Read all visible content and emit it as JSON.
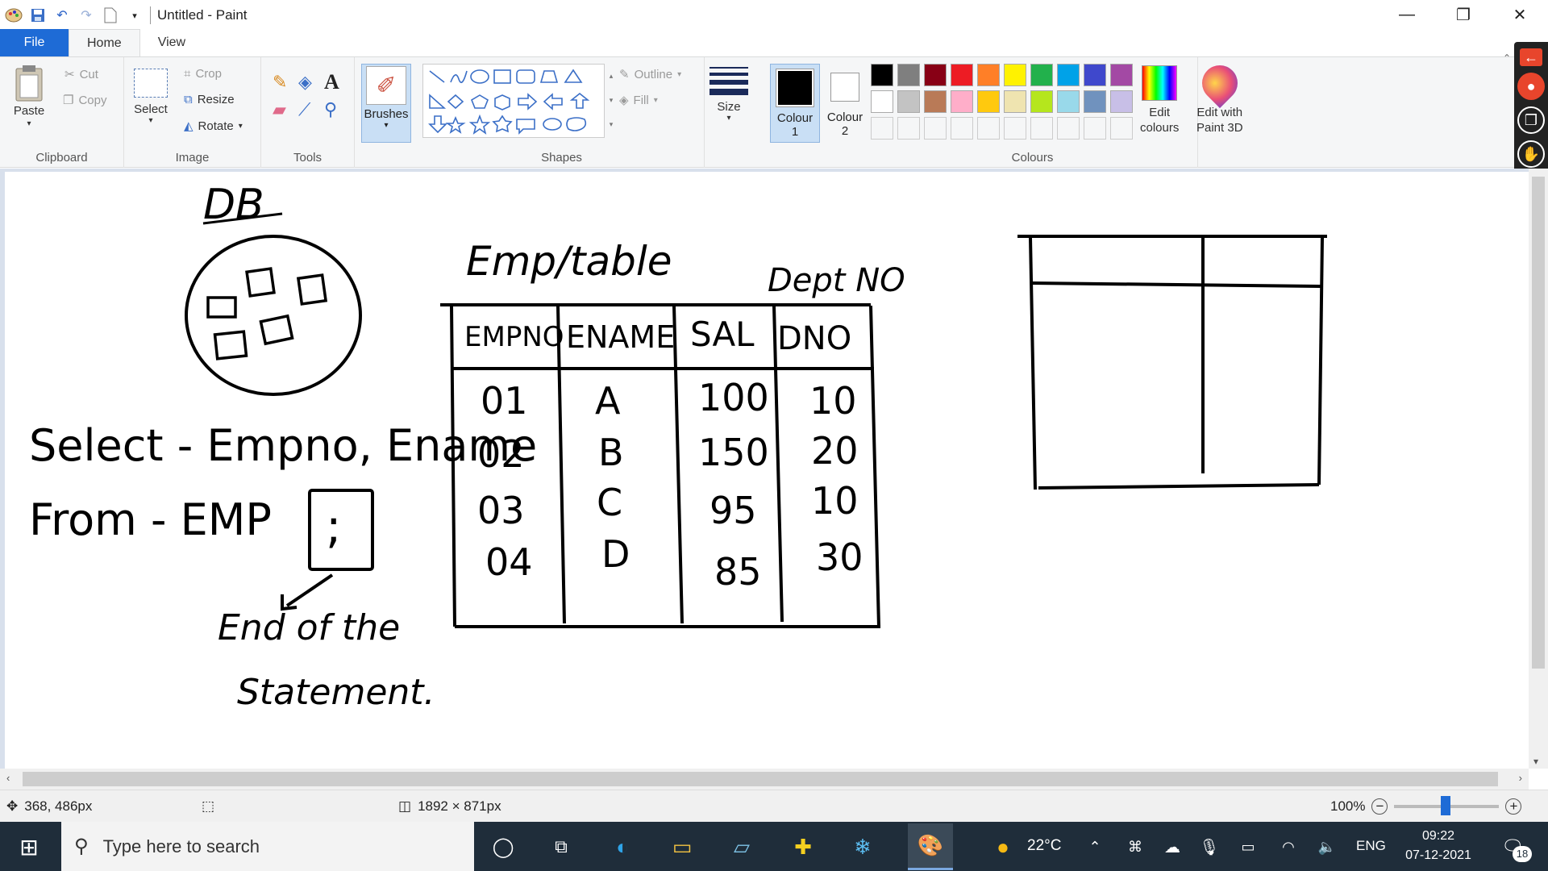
{
  "window": {
    "title": "Untitled - Paint",
    "controls": [
      "—",
      "❐",
      "✕"
    ]
  },
  "tabs": [
    {
      "label": "File"
    },
    {
      "label": "Home"
    },
    {
      "label": "View"
    }
  ],
  "ribbon": {
    "clipboard": {
      "paste": "Paste",
      "cut": "Cut",
      "copy": "Copy",
      "group": "Clipboard"
    },
    "image": {
      "select": "Select",
      "crop": "Crop",
      "resize": "Resize",
      "rotate": "Rotate",
      "group": "Image"
    },
    "tools": {
      "group": "Tools"
    },
    "brushes": {
      "label": "Brushes"
    },
    "shapes": {
      "outline": "Outline",
      "fill": "Fill",
      "group": "Shapes"
    },
    "size": {
      "label": "Size"
    },
    "colour1": {
      "label": "Colour",
      "num": "1"
    },
    "colour2": {
      "label": "Colour",
      "num": "2"
    },
    "colours": {
      "group": "Colours",
      "edit": "Edit",
      "edit2": "colours"
    },
    "paint3d": {
      "label1": "Edit with",
      "label2": "Paint 3D"
    },
    "palette": [
      "#000000",
      "#7f7f7f",
      "#880015",
      "#ed1c24",
      "#ff7f27",
      "#fff200",
      "#22b14c",
      "#00a2e8",
      "#3f48cc",
      "#a349a4",
      "#ffffff",
      "#c3c3c3",
      "#b97a57",
      "#ffaec9",
      "#ffc90e",
      "#efe4b0",
      "#b5e61d",
      "#99d9ea",
      "#7092be",
      "#c8bfe7"
    ]
  },
  "drawing": {
    "db_label": "DB",
    "sql_line1": "Select - Empno, Ename",
    "sql_line2": "From - EMP",
    "semicolon": ";",
    "note1": "End of the",
    "note2": "Statement.",
    "table_title": "Emp/table",
    "dept_label": "Dept NO",
    "headers": [
      "EMPNO",
      "ENAME",
      "SAL",
      "DNO"
    ],
    "rows": [
      [
        "01",
        "A",
        "100",
        "10"
      ],
      [
        "02",
        "B",
        "150",
        "20"
      ],
      [
        "03",
        "C",
        "95",
        "10"
      ],
      [
        "04",
        "D",
        "85",
        "30"
      ]
    ]
  },
  "status": {
    "cursor": "368, 486px",
    "canvas_size": "1892 × 871px",
    "zoom": "100%"
  },
  "taskbar": {
    "search_placeholder": "Type here to search",
    "temp": "22°C",
    "lang": "ENG",
    "time": "09:22",
    "date": "07-12-2021",
    "notif": "18"
  }
}
